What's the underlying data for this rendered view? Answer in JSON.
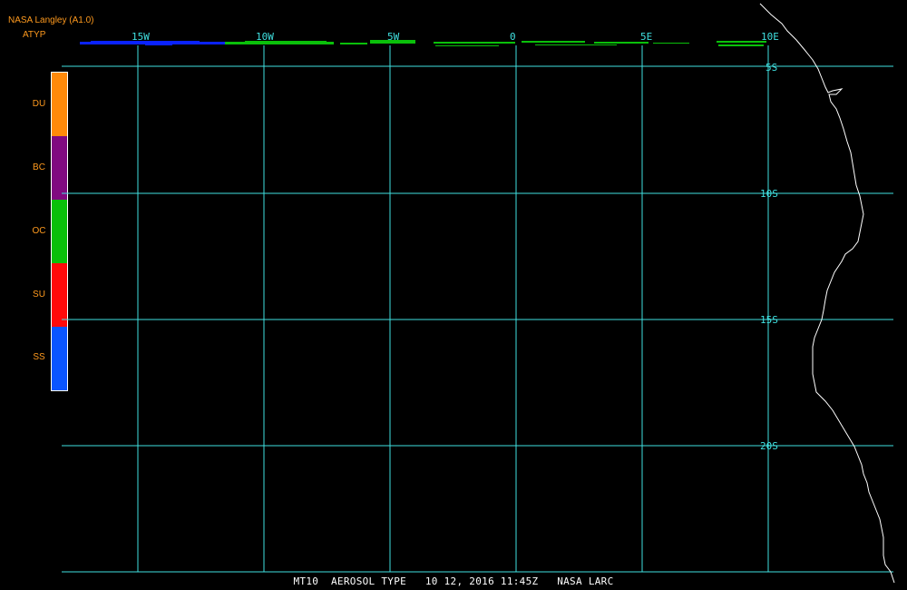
{
  "header": {
    "title": "NASA Langley (A1.0)",
    "product": "ATYP"
  },
  "legend": {
    "items": [
      {
        "label": "DU",
        "color": "#ff8a0a"
      },
      {
        "label": "BC",
        "color": "#800a80"
      },
      {
        "label": "OC",
        "color": "#0ac00a"
      },
      {
        "label": "SU",
        "color": "#ff0a0a"
      },
      {
        "label": "SS",
        "color": "#0a55ff"
      }
    ]
  },
  "map": {
    "lon_labels": [
      "15W",
      "10W",
      "5W",
      "0",
      "5E",
      "10E"
    ],
    "lat_labels": [
      "5S",
      "10S",
      "15S",
      "20S"
    ],
    "grid_color": "#40e0e0",
    "coast_color": "#ffffff"
  },
  "footer": {
    "text": "MT10  AEROSOL TYPE   10 12, 2016 11:45Z   NASA LARC"
  }
}
